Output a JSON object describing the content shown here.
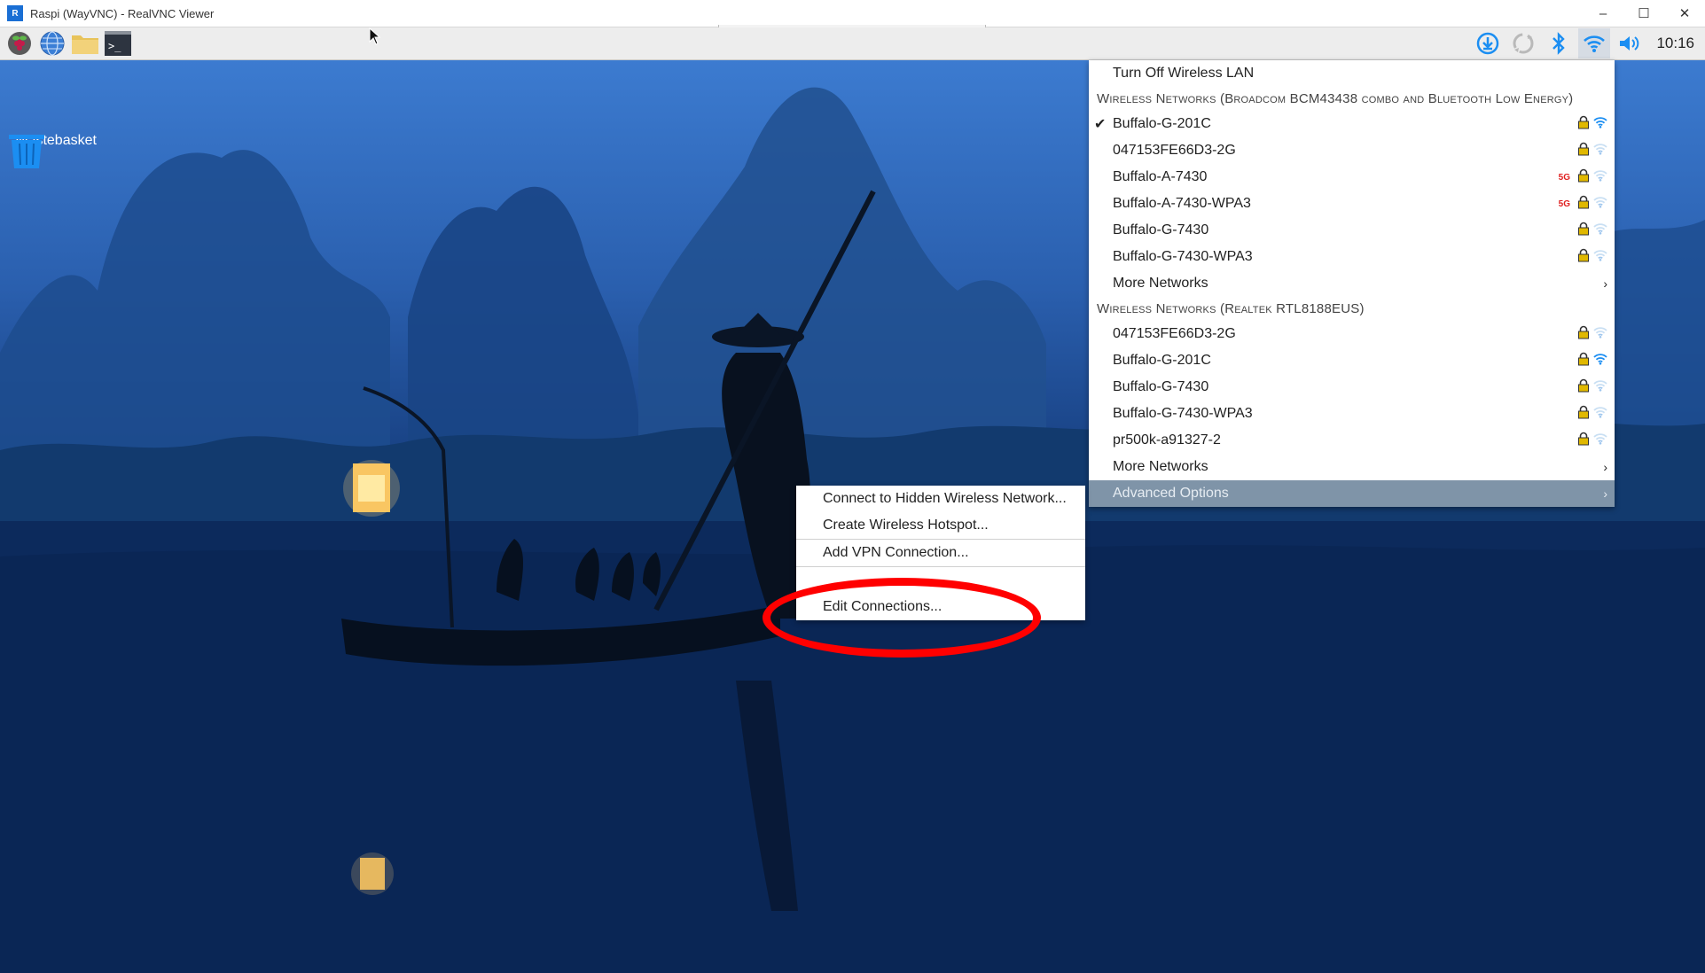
{
  "window": {
    "title": "Raspi (WayVNC) - RealVNC Viewer",
    "app_icon_text": "R",
    "controls": {
      "minimize": "–",
      "maximize": "☐",
      "close": "✕"
    }
  },
  "taskbar": {
    "launchers": [
      "raspberry-menu-icon",
      "web-browser-icon",
      "file-manager-icon",
      "terminal-icon"
    ],
    "terminal_glyph": ">_",
    "tray": [
      "updates-icon",
      "sync-icon",
      "bluetooth-icon",
      "wifi-icon",
      "volume-icon"
    ],
    "clock": "10:16"
  },
  "desktop": {
    "wastebasket_label": "Wastebasket"
  },
  "wifi_menu": {
    "turn_off": "Turn Off Wireless LAN",
    "section1_header": "Wireless Networks (Broadcom BCM43438 combo and Bluetooth Low Energy)",
    "section1_networks": [
      {
        "ssid": "Buffalo-G-201C",
        "connected": true,
        "band": "",
        "strength": "strong"
      },
      {
        "ssid": "047153FE66D3-2G",
        "connected": false,
        "band": "",
        "strength": "weak"
      },
      {
        "ssid": "Buffalo-A-7430",
        "connected": false,
        "band": "5G",
        "strength": "weak"
      },
      {
        "ssid": "Buffalo-A-7430-WPA3",
        "connected": false,
        "band": "5G",
        "strength": "weak"
      },
      {
        "ssid": "Buffalo-G-7430",
        "connected": false,
        "band": "",
        "strength": "weak"
      },
      {
        "ssid": "Buffalo-G-7430-WPA3",
        "connected": false,
        "band": "",
        "strength": "weak"
      }
    ],
    "more_networks_1": "More Networks",
    "section2_header": "Wireless Networks (Realtek RTL8188EUS)",
    "section2_networks": [
      {
        "ssid": "047153FE66D3-2G",
        "strength": "weak"
      },
      {
        "ssid": "Buffalo-G-201C",
        "strength": "strong"
      },
      {
        "ssid": "Buffalo-G-7430",
        "strength": "weak"
      },
      {
        "ssid": "Buffalo-G-7430-WPA3",
        "strength": "weak"
      },
      {
        "ssid": "pr500k-a91327-2",
        "strength": "weak"
      }
    ],
    "more_networks_2": "More Networks",
    "advanced_options": "Advanced Options",
    "check_glyph": "✔",
    "arrow_glyph": "›",
    "band_5g": "5G"
  },
  "advanced_submenu": {
    "hidden_network": "Connect to Hidden Wireless Network...",
    "hotspot": "Create Wireless Hotspot...",
    "add_vpn": "Add VPN Connection...",
    "edit_connections": "Edit Connections..."
  },
  "colors": {
    "highlight": "#7f94a8",
    "wifi_strong": "#1b8ef2",
    "lock": "#d9b000",
    "annotation": "#ff0000"
  }
}
